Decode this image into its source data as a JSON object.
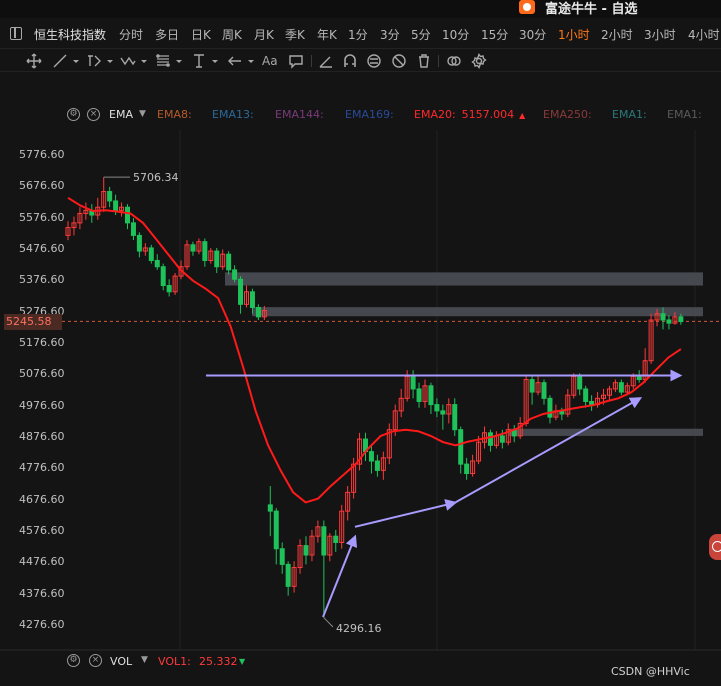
{
  "app": {
    "title": "富途牛牛 - 自选"
  },
  "symbol": "恒生科技指数",
  "periods": [
    {
      "label": "分时",
      "x": 119
    },
    {
      "label": "多日",
      "x": 155
    },
    {
      "label": "日K",
      "x": 191
    },
    {
      "label": "周K",
      "x": 222
    },
    {
      "label": "月K",
      "x": 254
    },
    {
      "label": "季K",
      "x": 285
    },
    {
      "label": "年K",
      "x": 317
    },
    {
      "label": "1分",
      "x": 348
    },
    {
      "label": "3分",
      "x": 380
    },
    {
      "label": "5分",
      "x": 411
    },
    {
      "label": "10分",
      "x": 442
    },
    {
      "label": "15分",
      "x": 481
    },
    {
      "label": "30分",
      "x": 519
    },
    {
      "label": "1小时",
      "x": 558
    },
    {
      "label": "2小时",
      "x": 601
    },
    {
      "label": "3小时",
      "x": 644
    },
    {
      "label": "4小时",
      "x": 688
    }
  ],
  "active_period": "1小时",
  "toolbar_icons": [
    "crosshair-icon",
    "line-icon",
    "pen-icon",
    "zigzag-icon",
    "fib-icon",
    "level-icon",
    "arrow-icon",
    "text-icon",
    "comment-icon",
    "ruler-icon",
    "magnet-icon",
    "lock-icon",
    "hide-icon",
    "trash-icon",
    "layers-icon",
    "settings-icon"
  ],
  "indicator_legend": {
    "name": "EMA",
    "items": [
      {
        "label": "EMA8:",
        "color": "#b85a2a"
      },
      {
        "label": "EMA13:",
        "color": "#2a6a9a"
      },
      {
        "label": "EMA144:",
        "color": "#7a3a7a"
      },
      {
        "label": "EMA169:",
        "color": "#2a4a9a"
      },
      {
        "label": "EMA20:",
        "value": "5157.004",
        "color": "#ff2a2a"
      },
      {
        "label": "EMA250:",
        "color": "#8a3a3a"
      },
      {
        "label": "EMA1:",
        "color": "#2a7a7a"
      },
      {
        "label": "EMA1:",
        "color": "#5a5a5a"
      }
    ]
  },
  "price_axis": [
    "5776.60",
    "5676.60",
    "5576.60",
    "5476.60",
    "5376.60",
    "5276.60",
    "5176.60",
    "5076.60",
    "4976.60",
    "4876.60",
    "4776.60",
    "4676.60",
    "4576.60",
    "4476.60",
    "4376.60",
    "4276.60"
  ],
  "current_price": "5245.58",
  "annotations": {
    "high": "5706.34",
    "low": "4296.16"
  },
  "volume_legend": {
    "name": "VOL",
    "item": "VOL1:",
    "value": "25.332"
  },
  "watermark": "CSDN @HHVic",
  "colors": {
    "up": "#ff3a3a",
    "down": "#1fc25a",
    "ema": "#ff1a1a",
    "zone": "#4a4e54",
    "trend": "#a89bff",
    "accent": "#ff7a1a"
  },
  "chart_data": {
    "type": "candlestick",
    "ylim": [
      4230,
      5810
    ],
    "indicator": "EMA20",
    "candles": [
      [
        5520,
        5545,
        5505,
        5565
      ],
      [
        5545,
        5560,
        5520,
        5580
      ],
      [
        5560,
        5590,
        5540,
        5610
      ],
      [
        5590,
        5600,
        5570,
        5625
      ],
      [
        5600,
        5585,
        5560,
        5620
      ],
      [
        5585,
        5610,
        5570,
        5640
      ],
      [
        5610,
        5660,
        5595,
        5706
      ],
      [
        5660,
        5630,
        5610,
        5675
      ],
      [
        5630,
        5600,
        5585,
        5650
      ],
      [
        5600,
        5610,
        5580,
        5625
      ],
      [
        5610,
        5560,
        5540,
        5620
      ],
      [
        5560,
        5520,
        5505,
        5575
      ],
      [
        5520,
        5470,
        5450,
        5530
      ],
      [
        5470,
        5480,
        5455,
        5495
      ],
      [
        5480,
        5440,
        5430,
        5490
      ],
      [
        5440,
        5420,
        5410,
        5460
      ],
      [
        5420,
        5360,
        5345,
        5430
      ],
      [
        5360,
        5340,
        5325,
        5380
      ],
      [
        5340,
        5390,
        5330,
        5400
      ],
      [
        5390,
        5420,
        5380,
        5440
      ],
      [
        5420,
        5490,
        5410,
        5505
      ],
      [
        5490,
        5470,
        5455,
        5500
      ],
      [
        5470,
        5500,
        5460,
        5510
      ],
      [
        5500,
        5440,
        5420,
        5510
      ],
      [
        5440,
        5470,
        5430,
        5480
      ],
      [
        5470,
        5420,
        5400,
        5480
      ],
      [
        5420,
        5460,
        5410,
        5475
      ],
      [
        5460,
        5410,
        5395,
        5470
      ],
      [
        5410,
        5380,
        5370,
        5425
      ],
      [
        5380,
        5300,
        5270,
        5390
      ],
      [
        5300,
        5340,
        5290,
        5360
      ],
      [
        5340,
        5290,
        5270,
        5350
      ],
      [
        5290,
        5260,
        5250,
        5300
      ],
      [
        5260,
        5280,
        5250,
        5295
      ],
      [
        4660,
        4640,
        4560,
        4720
      ],
      [
        4640,
        4520,
        4470,
        4650
      ],
      [
        4520,
        4470,
        4440,
        4540
      ],
      [
        4470,
        4400,
        4370,
        4480
      ],
      [
        4400,
        4460,
        4380,
        4480
      ],
      [
        4460,
        4530,
        4440,
        4550
      ],
      [
        4530,
        4500,
        4470,
        4560
      ],
      [
        4500,
        4560,
        4480,
        4580
      ],
      [
        4560,
        4590,
        4540,
        4610
      ],
      [
        4590,
        4500,
        4300,
        4610
      ],
      [
        4500,
        4560,
        4480,
        4570
      ],
      [
        4560,
        4540,
        4510,
        4580
      ],
      [
        4540,
        4640,
        4520,
        4660
      ],
      [
        4640,
        4700,
        4610,
        4720
      ],
      [
        4700,
        4790,
        4680,
        4810
      ],
      [
        4790,
        4870,
        4770,
        4890
      ],
      [
        4870,
        4830,
        4800,
        4890
      ],
      [
        4830,
        4800,
        4760,
        4850
      ],
      [
        4800,
        4770,
        4750,
        4820
      ],
      [
        4770,
        4810,
        4740,
        4830
      ],
      [
        4810,
        4900,
        4790,
        4920
      ],
      [
        4900,
        4960,
        4880,
        4980
      ],
      [
        4960,
        5000,
        4940,
        5030
      ],
      [
        5000,
        5070,
        4990,
        5090
      ],
      [
        5070,
        5030,
        5000,
        5090
      ],
      [
        5030,
        4990,
        4970,
        5050
      ],
      [
        4990,
        5040,
        4970,
        5060
      ],
      [
        5040,
        4980,
        4950,
        5050
      ],
      [
        4980,
        4960,
        4940,
        5000
      ],
      [
        4960,
        4950,
        4900,
        4980
      ],
      [
        4950,
        4980,
        4920,
        5000
      ],
      [
        4980,
        4900,
        4880,
        5000
      ],
      [
        4900,
        4790,
        4760,
        4910
      ],
      [
        4790,
        4760,
        4740,
        4810
      ],
      [
        4760,
        4800,
        4750,
        4820
      ],
      [
        4800,
        4860,
        4790,
        4880
      ],
      [
        4860,
        4890,
        4840,
        4910
      ],
      [
        4890,
        4850,
        4830,
        4900
      ],
      [
        4850,
        4880,
        4840,
        4895
      ],
      [
        4880,
        4860,
        4840,
        4900
      ],
      [
        4860,
        4900,
        4850,
        4920
      ],
      [
        4900,
        4880,
        4860,
        4915
      ],
      [
        4880,
        4920,
        4870,
        4940
      ],
      [
        4920,
        5060,
        4910,
        5070
      ],
      [
        5060,
        5020,
        4980,
        5070
      ],
      [
        5020,
        5050,
        5010,
        5070
      ],
      [
        5050,
        5000,
        4980,
        5060
      ],
      [
        5000,
        4940,
        4920,
        5010
      ],
      [
        4940,
        4960,
        4930,
        4980
      ],
      [
        4960,
        4950,
        4930,
        4970
      ],
      [
        4950,
        5010,
        4940,
        5030
      ],
      [
        5010,
        5070,
        5000,
        5080
      ],
      [
        5070,
        5030,
        5010,
        5080
      ],
      [
        5030,
        4990,
        4970,
        5040
      ],
      [
        4990,
        4980,
        4960,
        5010
      ],
      [
        4980,
        5000,
        4970,
        5020
      ],
      [
        5000,
        5010,
        4980,
        5030
      ],
      [
        5010,
        5030,
        4995,
        5040
      ],
      [
        5030,
        5050,
        5020,
        5060
      ],
      [
        5050,
        5020,
        5010,
        5060
      ],
      [
        5020,
        5040,
        5010,
        5050
      ],
      [
        5040,
        5070,
        5030,
        5080
      ],
      [
        5070,
        5060,
        5050,
        5090
      ],
      [
        5060,
        5120,
        5050,
        5160
      ],
      [
        5120,
        5250,
        5110,
        5270
      ],
      [
        5250,
        5270,
        5230,
        5285
      ],
      [
        5270,
        5250,
        5220,
        5290
      ],
      [
        5250,
        5240,
        5220,
        5265
      ],
      [
        5240,
        5260,
        5235,
        5275
      ],
      [
        5260,
        5245,
        5235,
        5270
      ]
    ],
    "ema": [
      5640,
      5615,
      5598,
      5600,
      5596,
      5590,
      5560,
      5510,
      5460,
      5410,
      5375,
      5350,
      5320,
      5230,
      5100,
      4960,
      4850,
      4770,
      4700,
      4668,
      4680,
      4720,
      4755,
      4790,
      4840,
      4880,
      4895,
      4900,
      4895,
      4880,
      4860,
      4850,
      4862,
      4870,
      4878,
      4890,
      4905,
      4935,
      4950,
      4958,
      4965,
      4972,
      4978,
      4990,
      5000,
      5018,
      5050,
      5090,
      5130,
      5157
    ],
    "zones": [
      {
        "x0": 225,
        "x1": 703,
        "y0": 5402,
        "y1": 5360
      },
      {
        "x0": 252,
        "x1": 703,
        "y0": 5291,
        "y1": 5262
      },
      {
        "x0": 509,
        "x1": 703,
        "y0": 4903,
        "y1": 4880
      }
    ],
    "resistance_line": {
      "y": 5073
    },
    "trend_arrows": [
      {
        "from": [
          355,
          4590
        ],
        "to": [
          455,
          4667
        ]
      },
      {
        "from": [
          455,
          4667
        ],
        "to": [
          640,
          5000
        ]
      },
      {
        "from": [
          323,
          4302
        ],
        "to": [
          355,
          4558
        ]
      }
    ]
  }
}
